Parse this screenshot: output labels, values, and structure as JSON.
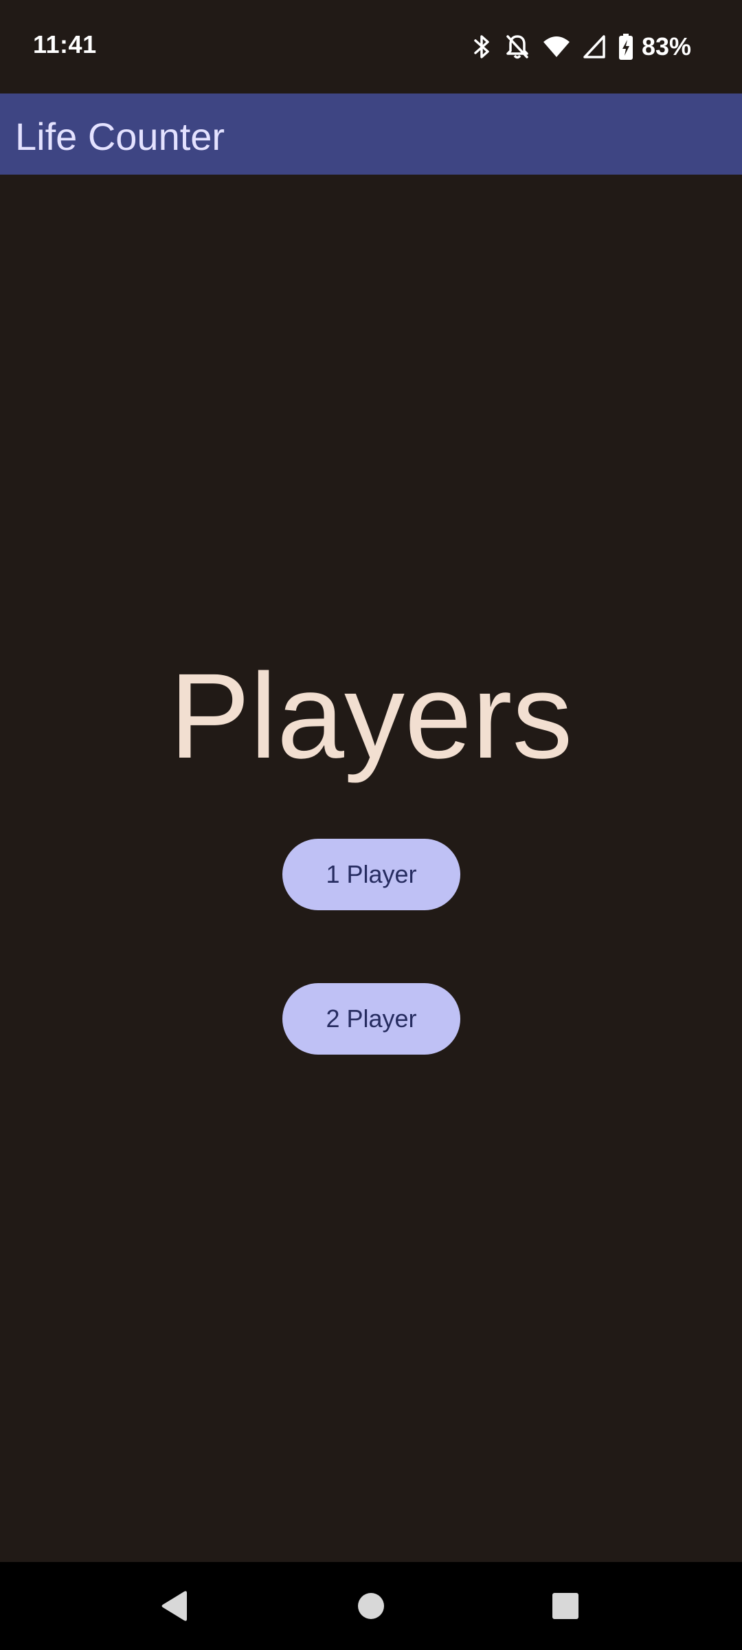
{
  "status_bar": {
    "time": "11:41",
    "battery_percent": "83%",
    "icons": [
      "bluetooth-icon",
      "notifications-off-icon",
      "wifi-icon",
      "cellular-signal-icon",
      "battery-charging-icon"
    ]
  },
  "app_bar": {
    "title": "Life Counter"
  },
  "main": {
    "heading": "Players",
    "buttons": [
      {
        "label": "1 Player"
      },
      {
        "label": "2 Player"
      }
    ]
  },
  "nav_bar": {
    "icons": [
      "back-icon",
      "home-icon",
      "recents-icon"
    ]
  },
  "colors": {
    "background": "#211a16",
    "app_bar": "#3e4583",
    "app_title": "#e4e2ff",
    "heading": "#f2dfd1",
    "button_bg": "#bfc1f5",
    "button_text": "#262c60"
  }
}
